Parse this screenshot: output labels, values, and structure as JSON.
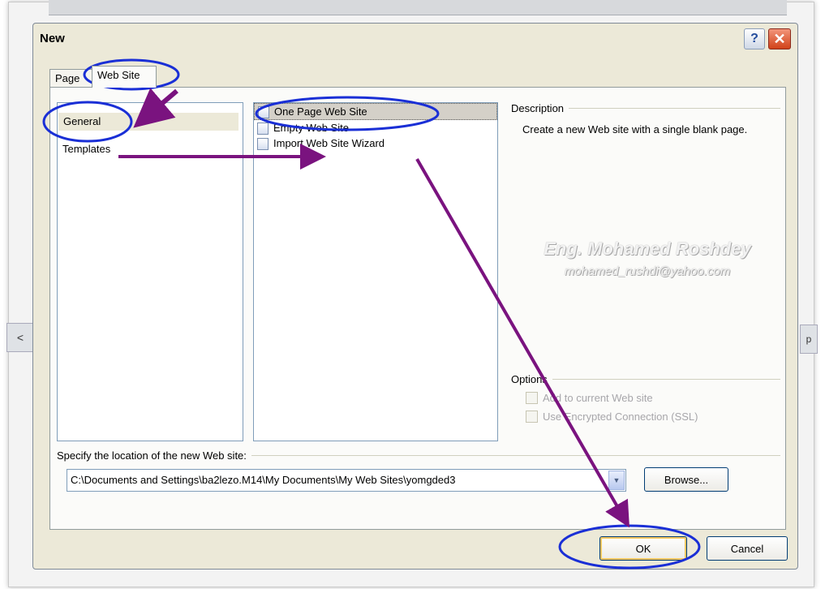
{
  "dialog": {
    "title": "New",
    "help_icon": "help-icon",
    "close_icon": "close-icon"
  },
  "tabs": [
    {
      "label": "Page"
    },
    {
      "label": "Web Site"
    }
  ],
  "categories": [
    {
      "label": "General"
    },
    {
      "label": "Templates"
    }
  ],
  "templates": [
    {
      "label": "One Page Web Site",
      "icon": "web-page-icon"
    },
    {
      "label": "Empty Web Site",
      "icon": "web-page-icon"
    },
    {
      "label": "Import Web Site Wizard",
      "icon": "web-page-icon"
    }
  ],
  "description": {
    "legend": "Description",
    "text": "Create a new Web site with a single blank page."
  },
  "watermark": {
    "line1": "Eng. Mohamed Roshdey",
    "line2": "mohamed_rushdi@yahoo.com"
  },
  "options": {
    "legend": "Options",
    "items": [
      {
        "label": "Add to current Web site"
      },
      {
        "label": "Use Encrypted Connection (SSL)"
      }
    ]
  },
  "location": {
    "label": "Specify the location of the new Web site:",
    "value": "C:\\Documents and Settings\\ba2lezo.M14\\My Documents\\My Web Sites\\yomgded3"
  },
  "buttons": {
    "browse": "Browse...",
    "ok": "OK",
    "cancel": "Cancel"
  },
  "background": {
    "left_arrow": "<",
    "right_label": "p"
  },
  "annotation_colors": {
    "circle": "#1a2fd6",
    "arrow": "#7a137f"
  }
}
